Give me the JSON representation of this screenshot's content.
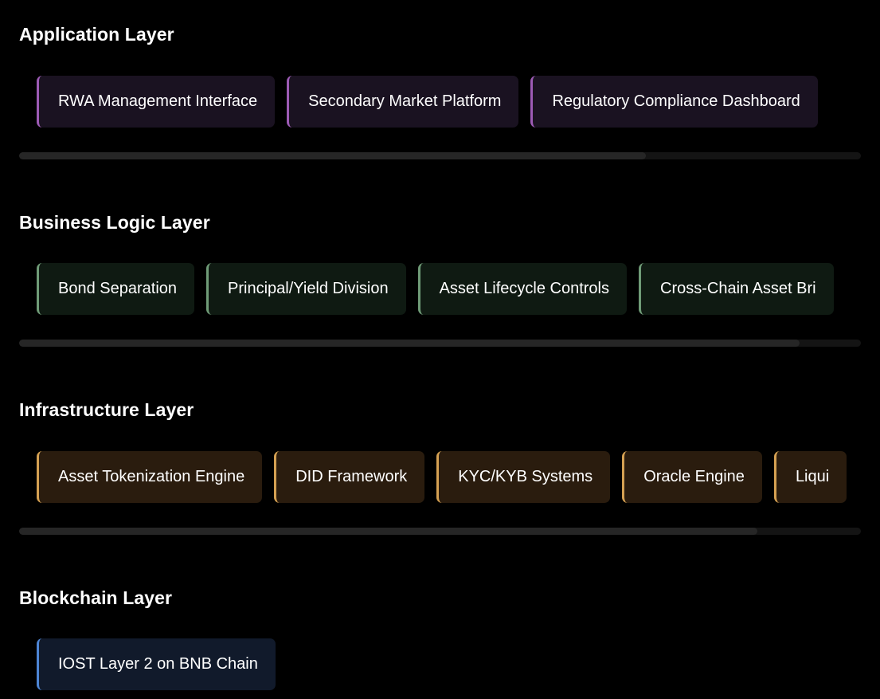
{
  "layers": [
    {
      "title": "Application Layer",
      "accent": "#9d5bb5",
      "background": "#1a1221",
      "items": [
        "RWA Management Interface",
        "Secondary Market Platform",
        "Regulatory Compliance Dashboard"
      ],
      "scroll_visible_fraction": 0.745
    },
    {
      "title": "Business Logic Layer",
      "accent": "#6f9b77",
      "background": "#0f1a12",
      "items": [
        "Bond Separation",
        "Principal/Yield Division",
        "Asset Lifecycle Controls",
        "Cross-Chain Asset Bri"
      ],
      "scroll_visible_fraction": 0.927
    },
    {
      "title": "Infrastructure Layer",
      "accent": "#d4a052",
      "background": "#2a1c0e",
      "items": [
        "Asset Tokenization Engine",
        "DID Framework",
        "KYC/KYB Systems",
        "Oracle Engine",
        "Liqui"
      ],
      "scroll_visible_fraction": 0.877
    },
    {
      "title": "Blockchain Layer",
      "accent": "#4d85d4",
      "background": "#111a2b",
      "items": [
        "IOST Layer 2 on BNB Chain"
      ]
    }
  ]
}
